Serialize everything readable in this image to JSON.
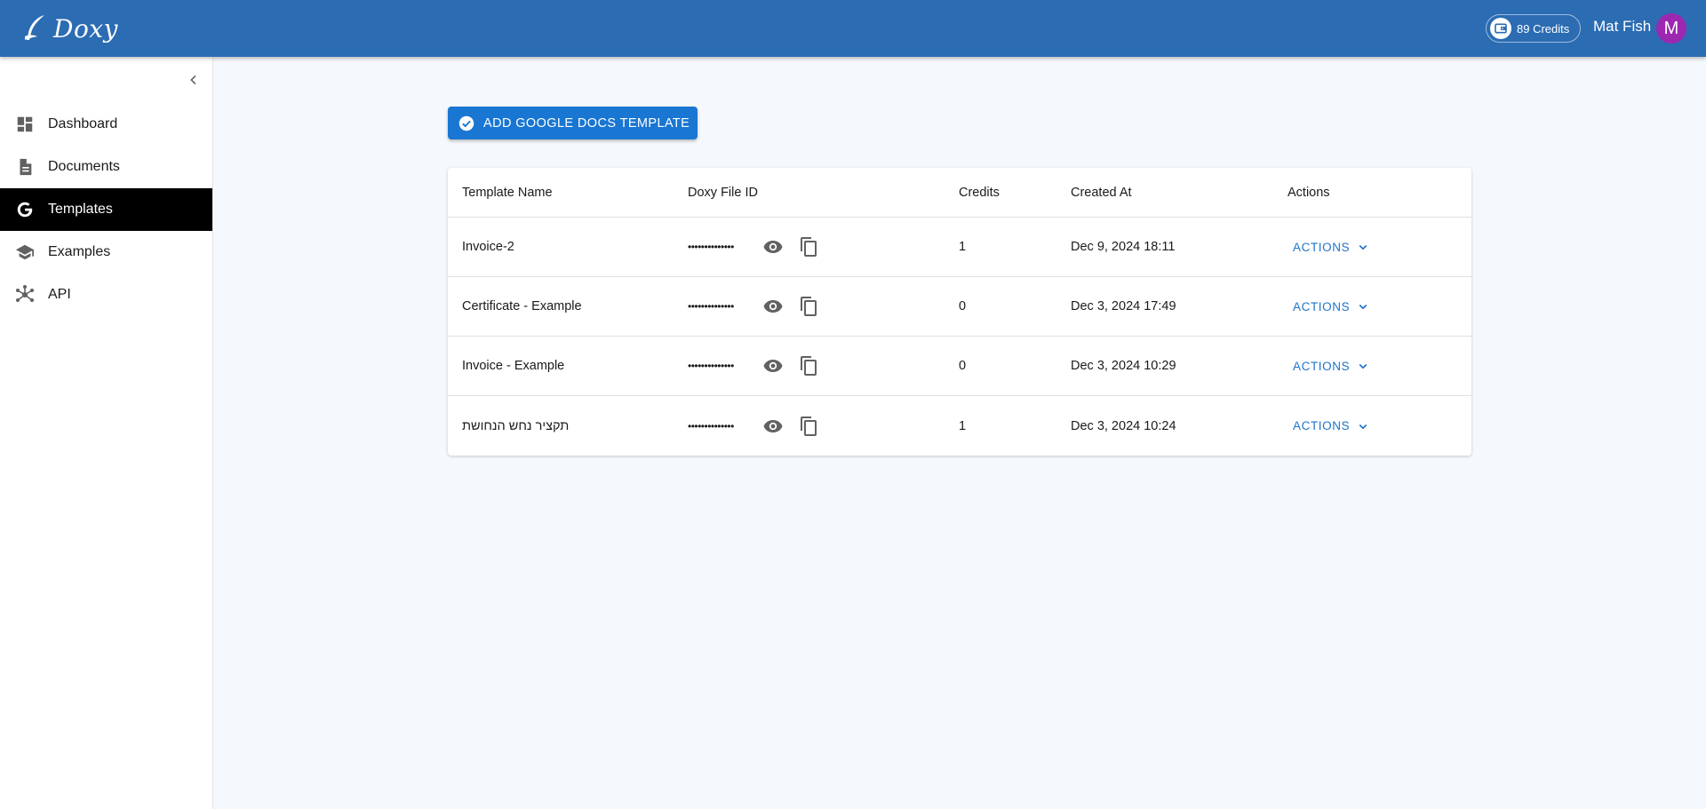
{
  "header": {
    "logo_text": "Doxy",
    "credits_label": "89 Credits",
    "user_name": "Mat Fish",
    "avatar_initial": "M"
  },
  "sidebar": {
    "items": [
      {
        "label": "Dashboard",
        "icon": "dashboard-icon"
      },
      {
        "label": "Documents",
        "icon": "document-icon"
      },
      {
        "label": "Templates",
        "icon": "google-icon",
        "active": true
      },
      {
        "label": "Examples",
        "icon": "school-icon"
      },
      {
        "label": "API",
        "icon": "hub-icon"
      }
    ]
  },
  "main": {
    "add_button_label": "ADD GOOGLE DOCS TEMPLATE",
    "table": {
      "headers": [
        "Template Name",
        "Doxy File ID",
        "Credits",
        "Created At",
        "Actions"
      ],
      "rows": [
        {
          "name": "Invoice-2",
          "file_id_masked": "••••••••••••••",
          "credits": "1",
          "created_at": "Dec 9, 2024 18:11",
          "action_label": "ACTIONS"
        },
        {
          "name": "Certificate - Example",
          "file_id_masked": "••••••••••••••",
          "credits": "0",
          "created_at": "Dec 3, 2024 17:49",
          "action_label": "ACTIONS"
        },
        {
          "name": "Invoice - Example",
          "file_id_masked": "••••••••••••••",
          "credits": "0",
          "created_at": "Dec 3, 2024 10:29",
          "action_label": "ACTIONS"
        },
        {
          "name": "תקציר נחש הנחושת",
          "file_id_masked": "••••••••••••••",
          "credits": "1",
          "created_at": "Dec 3, 2024 10:24",
          "action_label": "ACTIONS"
        }
      ]
    }
  },
  "colors": {
    "header_bg": "#2b6cb3",
    "primary": "#1976d2",
    "action_text": "#1e73c9",
    "avatar_bg": "#9c27b0",
    "active_nav_bg": "#000000",
    "page_bg": "#f5f8fc"
  }
}
